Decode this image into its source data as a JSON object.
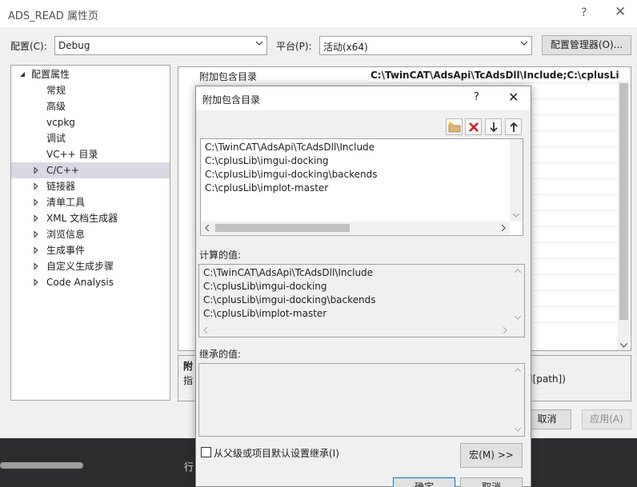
{
  "window": {
    "title": "ADS_READ 属性页",
    "help_glyph": "?",
    "close_glyph": "✕"
  },
  "toolbar": {
    "config_label": "配置(C):",
    "config_value": "Debug",
    "platform_label": "平台(P):",
    "platform_value": "活动(x64)",
    "config_manager_label": "配置管理器(O)..."
  },
  "tree": {
    "root": "配置属性",
    "items": [
      {
        "label": "常规",
        "expandable": false
      },
      {
        "label": "高级",
        "expandable": false
      },
      {
        "label": "vcpkg",
        "expandable": false
      },
      {
        "label": "调试",
        "expandable": false
      },
      {
        "label": "VC++ 目录",
        "expandable": false
      },
      {
        "label": "C/C++",
        "expandable": true,
        "selected": true
      },
      {
        "label": "链接器",
        "expandable": true
      },
      {
        "label": "清单工具",
        "expandable": true
      },
      {
        "label": "XML 文档生成器",
        "expandable": true
      },
      {
        "label": "浏览信息",
        "expandable": true
      },
      {
        "label": "生成事件",
        "expandable": true
      },
      {
        "label": "自定义生成步骤",
        "expandable": true
      },
      {
        "label": "Code Analysis",
        "expandable": true
      }
    ]
  },
  "grid": {
    "property_name": "附加包含目录",
    "property_value": "C:\\TwinCAT\\AdsApi\\TcAdsDll\\Include;C:\\cplusLib\\"
  },
  "description": {
    "title": "附",
    "text": "指",
    "tail": "/I[path])"
  },
  "main_buttons": {
    "cancel": "取消",
    "apply": "应用(A)"
  },
  "ide": {
    "row_label": "行"
  },
  "dialog": {
    "title": "附加包含目录",
    "help_glyph": "?",
    "close_glyph": "✕",
    "tools": [
      "new-folder-icon",
      "delete-icon",
      "move-down-icon",
      "move-up-icon"
    ],
    "edit_items": [
      "C:\\TwinCAT\\AdsApi\\TcAdsDll\\Include",
      "C:\\cplusLib\\imgui-docking",
      "C:\\cplusLib\\imgui-docking\\backends",
      "C:\\cplusLib\\implot-master"
    ],
    "computed_label": "计算的值:",
    "computed_items": [
      "C:\\TwinCAT\\AdsApi\\TcAdsDll\\Include",
      "C:\\cplusLib\\imgui-docking",
      "C:\\cplusLib\\imgui-docking\\backends",
      "C:\\cplusLib\\implot-master"
    ],
    "inherited_label": "继承的值:",
    "inherit_checkbox_label": "从父级或项目默认设置继承(I)",
    "inherit_checked": false,
    "macro_button": "宏(M) >>",
    "ok_button": "确定",
    "cancel_button": "取消"
  },
  "colors": {
    "window_bg": "#f0f0f0",
    "selection": "#d9d9e4",
    "ide_bg": "#2d2d30",
    "accent": "#0078d7"
  }
}
